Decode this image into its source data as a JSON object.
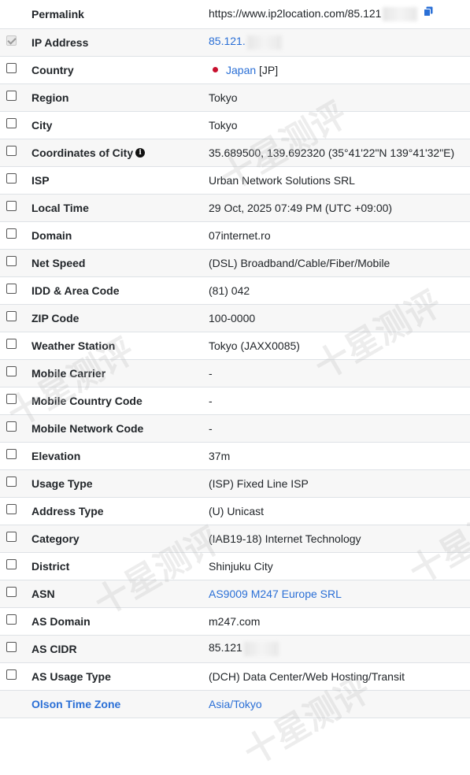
{
  "rows": [
    {
      "label": "Permalink",
      "value": "https://www.ip2location.com/85.121",
      "checked": false,
      "no_checkbox": true
    },
    {
      "label": "IP Address",
      "value": "85.121.",
      "checked": true,
      "value_link": true
    },
    {
      "label": "Country",
      "value": "Japan",
      "suffix": "[JP]",
      "checked": false,
      "value_link": true
    },
    {
      "label": "Region",
      "value": "Tokyo",
      "checked": false
    },
    {
      "label": "City",
      "value": "Tokyo",
      "checked": false
    },
    {
      "label": "Coordinates of City",
      "value": "35.689500, 139.692320 (35°41'22\"N   139°41'32\"E)",
      "checked": false
    },
    {
      "label": "ISP",
      "value": "Urban Network Solutions SRL",
      "checked": false
    },
    {
      "label": "Local Time",
      "value": "29 Oct, 2025 07:49 PM (UTC +09:00)",
      "checked": false
    },
    {
      "label": "Domain",
      "value": "07internet.ro",
      "checked": false
    },
    {
      "label": "Net Speed",
      "value": "(DSL) Broadband/Cable/Fiber/Mobile",
      "checked": false
    },
    {
      "label": "IDD & Area Code",
      "value": "(81) 042",
      "checked": false
    },
    {
      "label": "ZIP Code",
      "value": "100-0000",
      "checked": false
    },
    {
      "label": "Weather Station",
      "value": "Tokyo (JAXX0085)",
      "checked": false
    },
    {
      "label": "Mobile Carrier",
      "value": "-",
      "checked": false
    },
    {
      "label": "Mobile Country Code",
      "value": "-",
      "checked": false
    },
    {
      "label": "Mobile Network Code",
      "value": "-",
      "checked": false
    },
    {
      "label": "Elevation",
      "value": "37m",
      "checked": false
    },
    {
      "label": "Usage Type",
      "value": "(ISP) Fixed Line ISP",
      "checked": false
    },
    {
      "label": "Address Type",
      "value": "(U) Unicast",
      "checked": false
    },
    {
      "label": "Category",
      "value": "(IAB19-18) Internet Technology",
      "checked": false
    },
    {
      "label": "District",
      "value": "Shinjuku City",
      "checked": false
    },
    {
      "label": "ASN",
      "value": "AS9009 M247 Europe SRL",
      "checked": false,
      "value_link": true
    },
    {
      "label": "AS Domain",
      "value": "m247.com",
      "checked": false
    },
    {
      "label": "AS CIDR",
      "value": "85.121",
      "checked": false
    },
    {
      "label": "AS Usage Type",
      "value": "(DCH) Data Center/Web Hosting/Transit",
      "checked": false
    },
    {
      "label": "Olson Time Zone",
      "value": "Asia/Tokyo",
      "checked": false,
      "no_checkbox": true,
      "label_link": true,
      "value_link": true
    }
  ],
  "watermark_text": "十星测评",
  "colors": {
    "link": "#2a6fd6",
    "row_alt": "#f7f7f7",
    "border": "#dee2e6",
    "flag_red": "#c8102e"
  }
}
